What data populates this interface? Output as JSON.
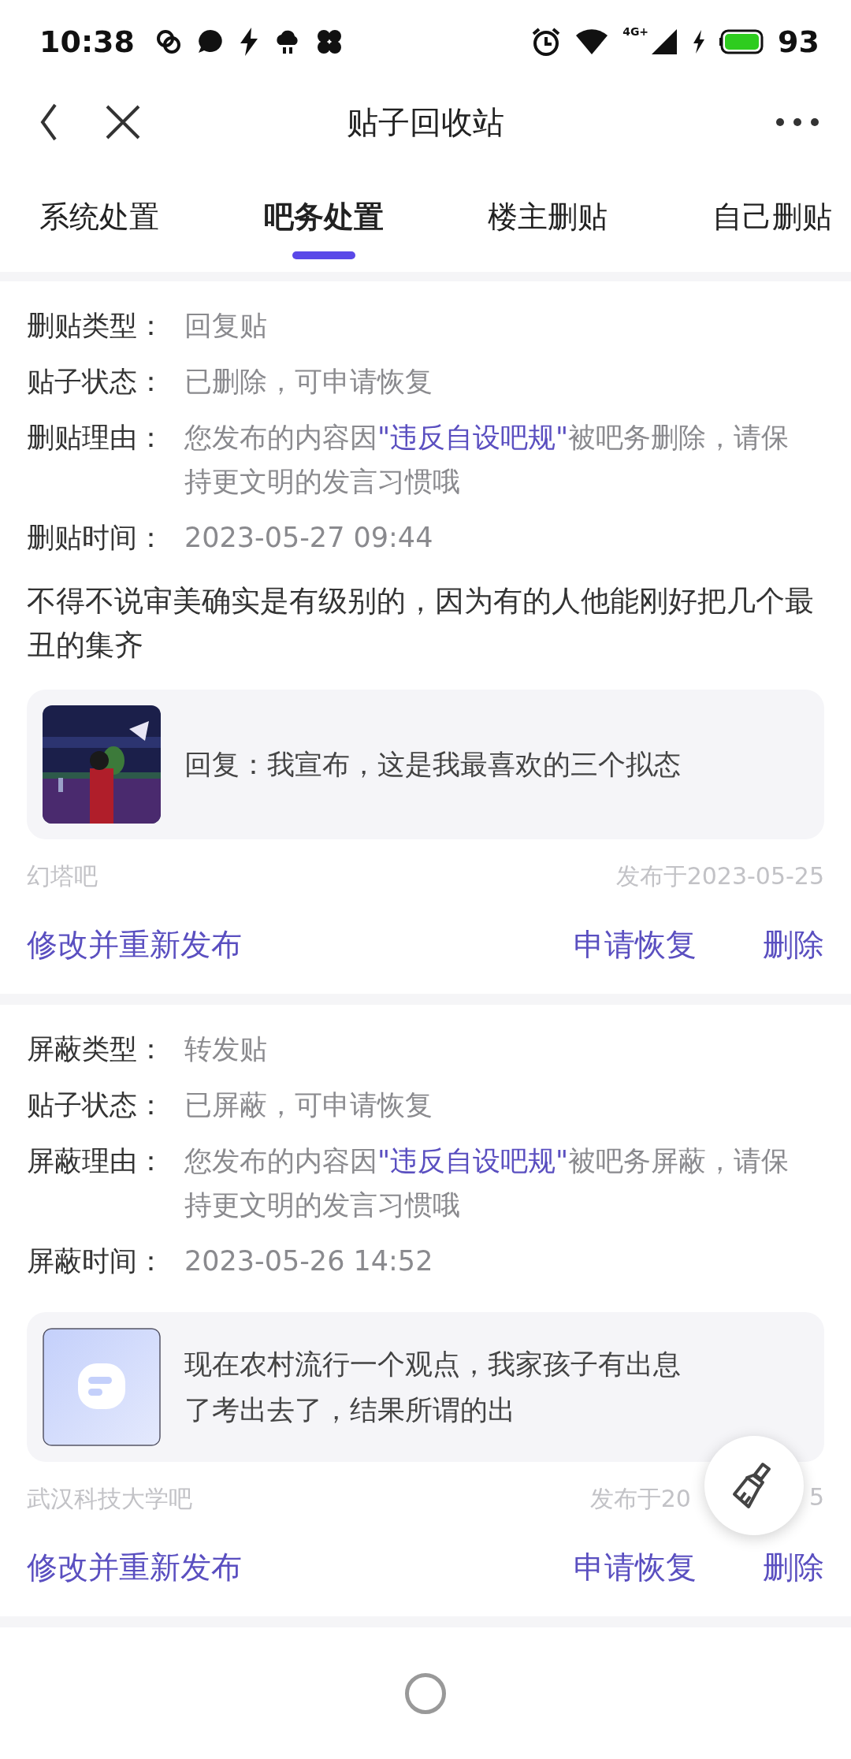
{
  "status_bar": {
    "time": "10:38",
    "network": "4G+",
    "battery": "93"
  },
  "header": {
    "title": "贴子回收站"
  },
  "tabs": [
    {
      "label": "系统处置",
      "selected": false
    },
    {
      "label": "吧务处置",
      "selected": true
    },
    {
      "label": "楼主删贴",
      "selected": false
    },
    {
      "label": "自己删贴",
      "selected": false
    }
  ],
  "cards": [
    {
      "fields": [
        {
          "kind": "plain",
          "label": "删贴类型：",
          "value": "回复贴"
        },
        {
          "kind": "plain",
          "label": "贴子状态：",
          "value": "已删除，可申请恢复"
        },
        {
          "kind": "reason",
          "label": "删贴理由：",
          "prefix": "您发布的内容因",
          "link": "\"违反自设吧规\"",
          "suffix": "被吧务删除，请保持更文明的发言习惯哦"
        },
        {
          "kind": "plain",
          "label": "删贴时间：",
          "value": "2023-05-27 09:44"
        }
      ],
      "body": "不得不说审美确实是有级别的，因为有的人他能刚好把几个最丑的集齐",
      "quote": {
        "kind": "picture",
        "text": "回复：我宣布，这是我最喜欢的三个拟态"
      },
      "forum": "幻塔吧",
      "date": "发布于2023-05-25",
      "actions": [
        "修改并重新发布",
        "申请恢复",
        "删除"
      ]
    },
    {
      "fields": [
        {
          "kind": "plain",
          "label": "屏蔽类型：",
          "value": "转发贴"
        },
        {
          "kind": "plain",
          "label": "贴子状态：",
          "value": "已屏蔽，可申请恢复"
        },
        {
          "kind": "reason",
          "label": "屏蔽理由：",
          "prefix": "您发布的内容因",
          "link": "\"违反自设吧规\"",
          "suffix": "被吧务屏蔽，请保持更文明的发言习惯哦"
        },
        {
          "kind": "plain",
          "label": "屏蔽时间：",
          "value": "2023-05-26 14:52"
        }
      ],
      "quote": {
        "kind": "placeholder",
        "text": "现在农村流行一个观点，我家孩子有出息了考出去了，结果所谓的出"
      },
      "forum": "武汉科技大学吧",
      "date": "发布于20",
      "date_end": "5",
      "actions": [
        "修改并重新发布",
        "申请恢复",
        "删除"
      ]
    }
  ]
}
